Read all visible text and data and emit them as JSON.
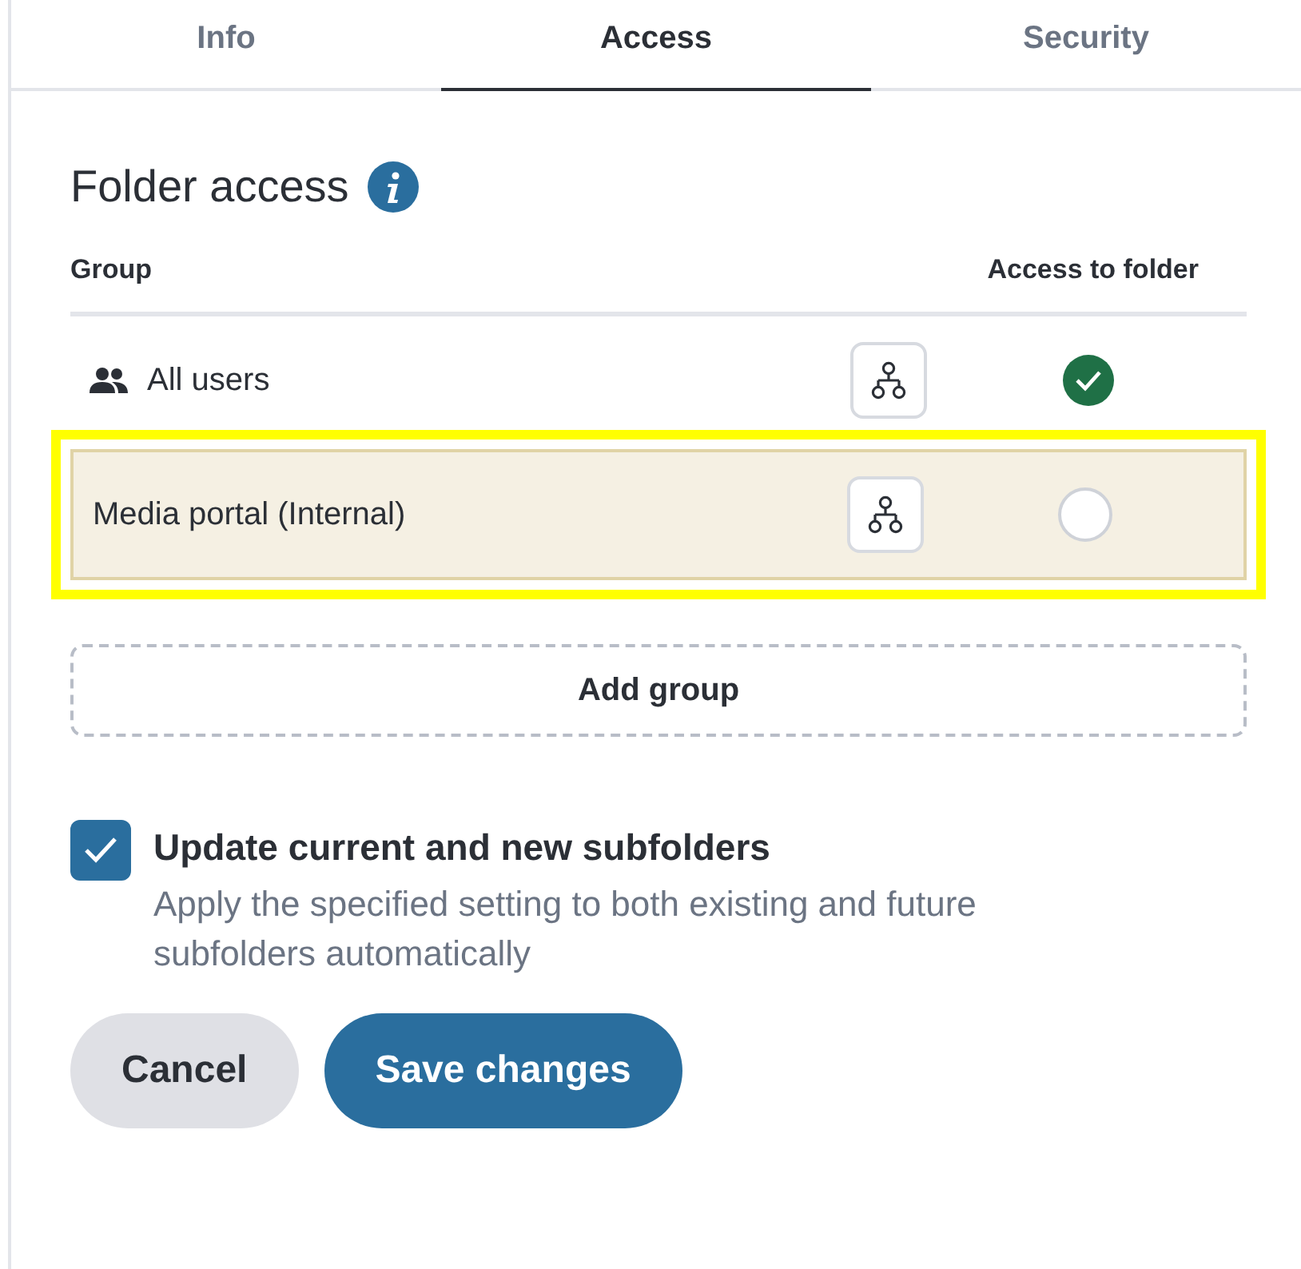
{
  "tabs": [
    {
      "label": "Info",
      "selected": false
    },
    {
      "label": "Access",
      "selected": true
    },
    {
      "label": "Security",
      "selected": false
    }
  ],
  "section": {
    "title": "Folder access"
  },
  "table": {
    "columns": [
      "Group",
      "Access to folder"
    ],
    "rows": [
      {
        "kind": "everyone",
        "name": "All users",
        "access": true,
        "highlighted": false
      },
      {
        "kind": "group",
        "name": "Media portal (Internal)",
        "access": false,
        "highlighted": true
      }
    ]
  },
  "add_button": "Add group",
  "subfolders": {
    "checked": true,
    "label": "Update current and new subfolders",
    "description": "Apply the specified setting to both existing and future subfolders automatically"
  },
  "buttons": [
    {
      "kind": "secondary",
      "label": "Cancel"
    },
    {
      "kind": "primary",
      "label": "Save changes"
    }
  ]
}
